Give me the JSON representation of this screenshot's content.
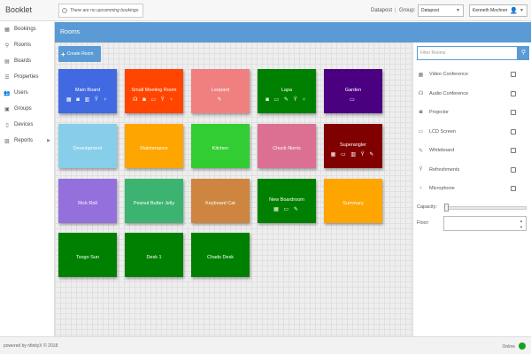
{
  "app": {
    "title": "Booklet"
  },
  "topbar": {
    "notice": "There are no upcomming bookings.",
    "notice_icon": "info-icon",
    "location": "Datapost",
    "group_label": "Group:",
    "group_value": "Datapost",
    "user_name": "Kenneth Mochner"
  },
  "sidebar": {
    "items": [
      {
        "label": "Bookings",
        "icon": "calendar-icon",
        "glyph": "▦"
      },
      {
        "label": "Rooms",
        "icon": "map-marker-icon",
        "glyph": "⚲"
      },
      {
        "label": "Boards",
        "icon": "board-icon",
        "glyph": "▤"
      },
      {
        "label": "Properties",
        "icon": "list-icon",
        "glyph": "☰"
      },
      {
        "label": "Users",
        "icon": "users-icon",
        "glyph": "👥"
      },
      {
        "label": "Groups",
        "icon": "groups-icon",
        "glyph": "▣"
      },
      {
        "label": "Devices",
        "icon": "device-icon",
        "glyph": "▯"
      },
      {
        "label": "Reports",
        "icon": "reports-icon",
        "glyph": "▨"
      }
    ]
  },
  "main": {
    "section_title": "Rooms",
    "create_button": "Create Room"
  },
  "rooms": [
    {
      "name": "Main Board",
      "color": "#4169e1",
      "icons": "▦ ◙ ▥ Ÿ ♀"
    },
    {
      "name": "Small Meeting Room",
      "color": "#ff4500",
      "icons": "☊ ◙ ▭ Ÿ ♀"
    },
    {
      "name": "Leopard",
      "color": "#f08080",
      "icons": "✎"
    },
    {
      "name": "Lapa",
      "color": "#008000",
      "icons": "◙ ▭ ✎ Ÿ ♀"
    },
    {
      "name": "Garden",
      "color": "#4b0082",
      "icons": "▭"
    },
    {
      "name": "Development",
      "color": "#87ceeb",
      "icons": ""
    },
    {
      "name": "Maintenance",
      "color": "#ffa500",
      "icons": ""
    },
    {
      "name": "Kitchen",
      "color": "#32cd32",
      "icons": ""
    },
    {
      "name": "Chuck Norris",
      "color": "#db7093",
      "icons": ""
    },
    {
      "name": "Superangler",
      "color": "#800000",
      "icons": "▦ ▭ ▥ Ÿ ✎"
    },
    {
      "name": "Rick Roll",
      "color": "#9370db",
      "icons": ""
    },
    {
      "name": "Peanut Butter Jelly",
      "color": "#3cb371",
      "icons": ""
    },
    {
      "name": "Keyboard Cat",
      "color": "#cd853f",
      "icons": ""
    },
    {
      "name": "New Boardroom",
      "color": "#008000",
      "icons": "▦ ▭ ✎"
    },
    {
      "name": "Summary",
      "color": "#ffa500",
      "icons": ""
    },
    {
      "name": "Tsogo Sun",
      "color": "#008000",
      "icons": ""
    },
    {
      "name": "Desk 1",
      "color": "#008000",
      "icons": ""
    },
    {
      "name": "Chads Desk",
      "color": "#008000",
      "icons": ""
    }
  ],
  "filters": {
    "placeholder": "Filter Rooms",
    "features": [
      {
        "label": "Video Conference",
        "icon": "film-icon",
        "glyph": "▦"
      },
      {
        "label": "Audio Conference",
        "icon": "headset-icon",
        "glyph": "☊"
      },
      {
        "label": "Projector",
        "icon": "projector-icon",
        "glyph": "◙"
      },
      {
        "label": "LCD Screen",
        "icon": "monitor-icon",
        "glyph": "▭"
      },
      {
        "label": "Whiteboard",
        "icon": "edit-icon",
        "glyph": "✎"
      },
      {
        "label": "Refreshments",
        "icon": "glass-icon",
        "glyph": "Ÿ"
      },
      {
        "label": "Microphone",
        "icon": "microphone-icon",
        "glyph": "♀"
      }
    ],
    "capacity_label": "Capacity:",
    "floor_label": "Floor:"
  },
  "footer": {
    "text": "powered by nfinityX © 2018",
    "status": "Online",
    "status_color": "#1aa11a"
  }
}
